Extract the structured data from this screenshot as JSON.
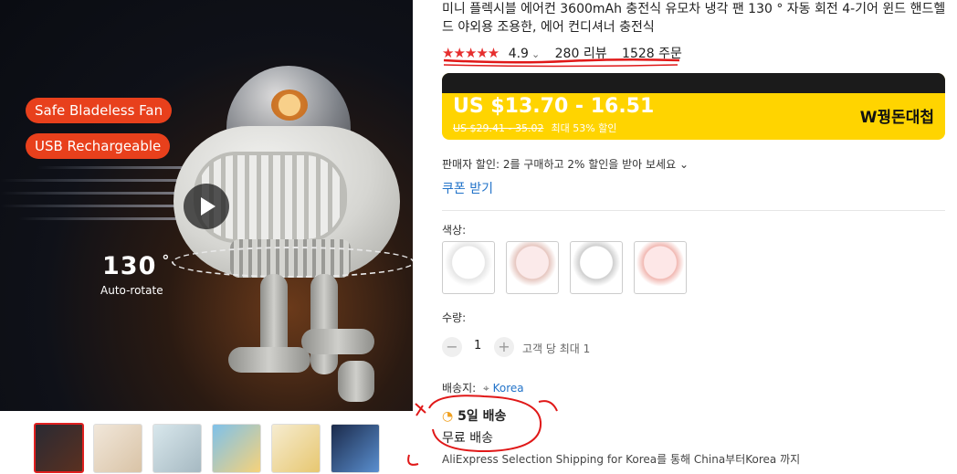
{
  "product": {
    "title": "미니 플렉시블 에어컨 3600mAh 충전식 유모차 냉각 팬 130 ° 자동 회전 4-기어 윈드 핸드헬드 야외용 조용한, 에어 컨디셔너 충전식",
    "rating": "4.9",
    "rating_caret": "⌄",
    "reviews": "280 리뷰",
    "orders": "1528 주문",
    "stars": "★★★★★"
  },
  "hero": {
    "badge1": "Safe Bladeless Fan",
    "badge2": "USB Rechargeable",
    "angle": "130",
    "angle_unit": "°",
    "angle_caption": "Auto-rotate"
  },
  "price": {
    "range": "US $13.70 - 16.51",
    "original": "US $29.41 - 35.02",
    "discount": "최대 53% 할인",
    "brand": "W꿩돈대첩"
  },
  "seller_discount": "판매자 할인: 2를 구매하고 2% 할인을 받아 보세요 ⌄",
  "coupon_link": "쿠폰 받기",
  "color_label": "색상:",
  "quantity": {
    "label": "수량:",
    "value": "1",
    "minus": "−",
    "plus": "+",
    "limit": "고객 당 최대 1"
  },
  "shipping": {
    "label": "배송지:",
    "location_icon": "pin-icon",
    "destination": "Korea",
    "days": "5일 배송",
    "free": "무료 배송",
    "via": "AliExpress Selection Shipping for Korea를 통해 China부터Korea 까지"
  },
  "colors": {
    "accent": "#e62e2e",
    "link": "#2273c9",
    "price_bg": "#ffd400"
  }
}
